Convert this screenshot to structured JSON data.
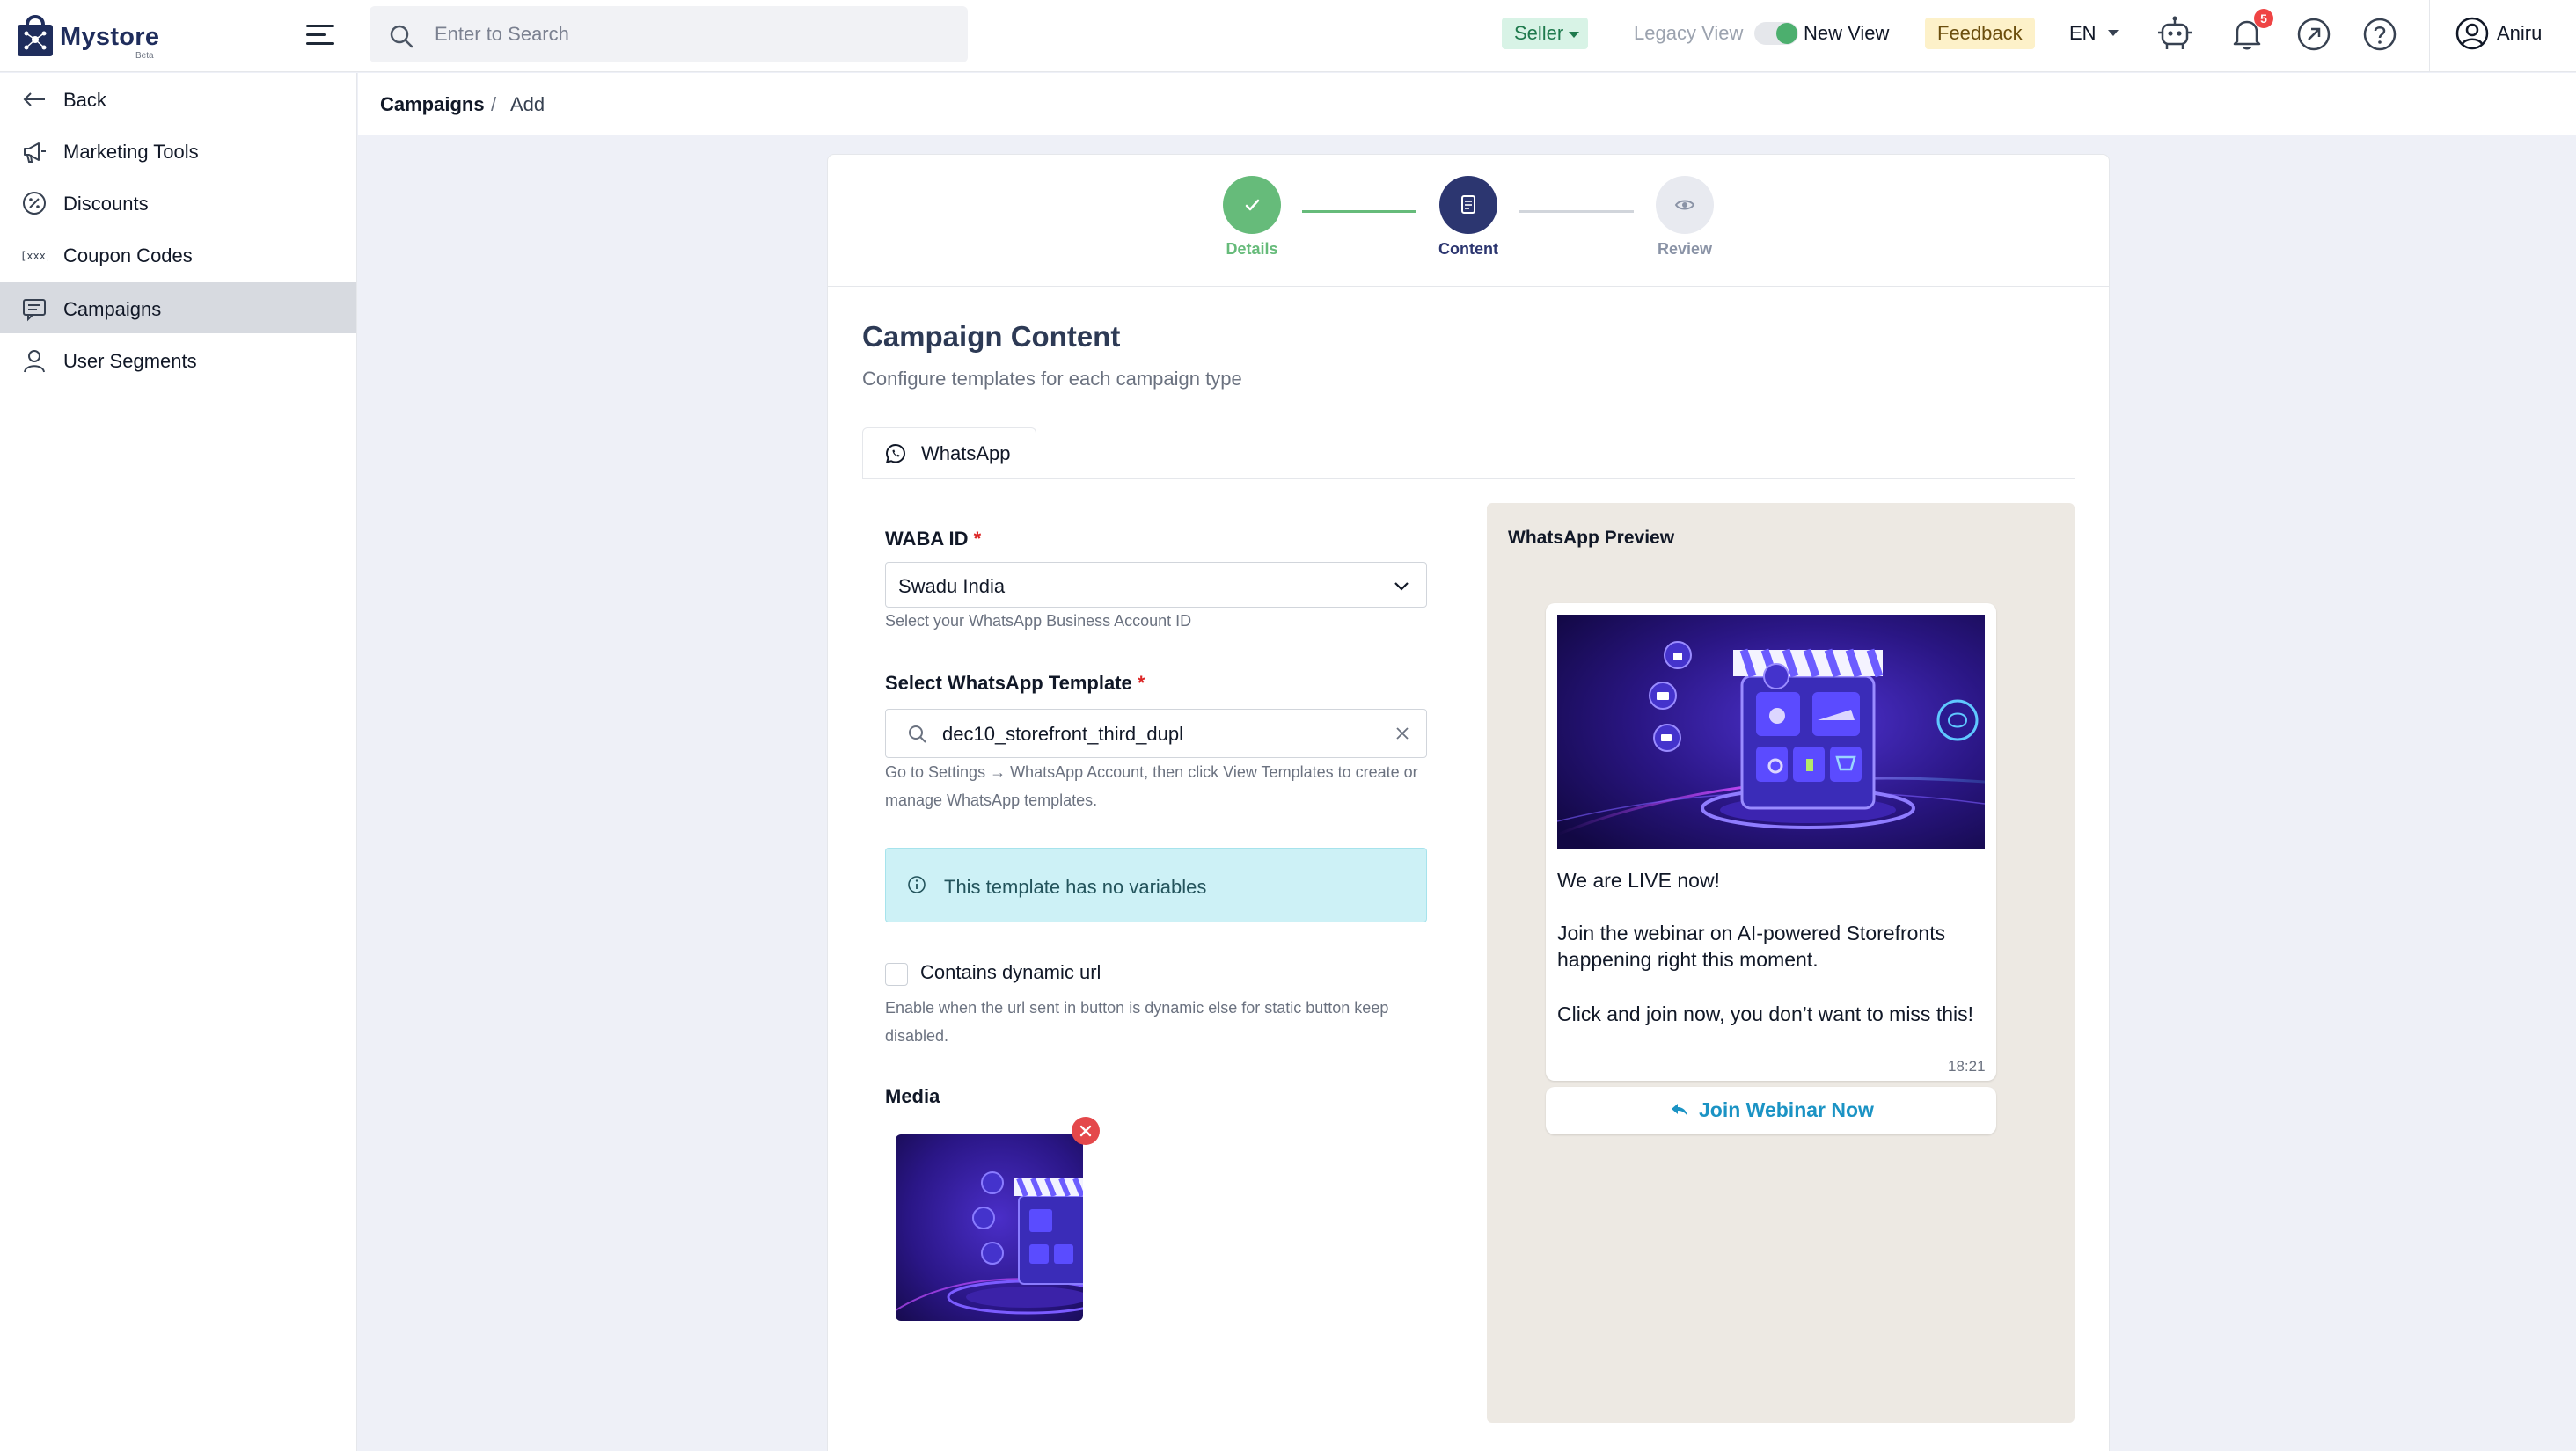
{
  "app": {
    "name": "Mystore",
    "beta": "Beta"
  },
  "search": {
    "placeholder": "Enter to Search"
  },
  "topbar": {
    "seller_label": "Seller",
    "legacy_view": "Legacy View",
    "new_view": "New View",
    "feedback": "Feedback",
    "language": "EN",
    "notifications_count": "5",
    "user_name": "Aniru"
  },
  "sidebar": {
    "items": [
      {
        "label": "Back",
        "icon": "arrow-left-icon",
        "active": false
      },
      {
        "label": "Marketing Tools",
        "icon": "megaphone-icon",
        "active": false
      },
      {
        "label": "Discounts",
        "icon": "percent-icon",
        "active": false
      },
      {
        "label": "Coupon Codes",
        "icon": "coupon-code-icon",
        "active": false
      },
      {
        "label": "Campaigns",
        "icon": "message-icon",
        "active": true
      },
      {
        "label": "User Segments",
        "icon": "user-icon",
        "active": false
      }
    ]
  },
  "breadcrumb": {
    "parent": "Campaigns",
    "separator": "/",
    "current": "Add"
  },
  "stepper": {
    "steps": [
      {
        "label": "Details",
        "state": "completed"
      },
      {
        "label": "Content",
        "state": "active"
      },
      {
        "label": "Review",
        "state": "pending"
      }
    ]
  },
  "content": {
    "title": "Campaign Content",
    "subtitle": "Configure templates for each campaign type",
    "tab": "WhatsApp"
  },
  "form": {
    "waba_label": "WABA ID",
    "waba_value": "Swadu India",
    "waba_hint": "Select your WhatsApp Business Account ID",
    "template_label": "Select WhatsApp Template",
    "template_value": "dec10_storefront_third_dupl",
    "template_hint": "Go to Settings → WhatsApp Account, then click View Templates to create or manage WhatsApp templates.",
    "info_text": "This template has no variables",
    "dynamic_url_label": "Contains dynamic url",
    "dynamic_url_checked": false,
    "dynamic_url_hint": "Enable when the url sent in button is dynamic else for static button keep disabled.",
    "media_label": "Media",
    "required_mark": "*"
  },
  "preview": {
    "title": "WhatsApp Preview",
    "line1": "We are LIVE now!",
    "line2": "Join the webinar on AI-powered Storefronts happening right this moment.",
    "line3": "Click and join now, you don’t want to miss this!",
    "time": "18:21",
    "button_label": "Join Webinar Now"
  },
  "colors": {
    "brand": "#1f2d5c",
    "success": "#66bb7a",
    "active_step": "#2c3670",
    "info_bg": "#cdf1f6",
    "link": "#1b93c4"
  }
}
